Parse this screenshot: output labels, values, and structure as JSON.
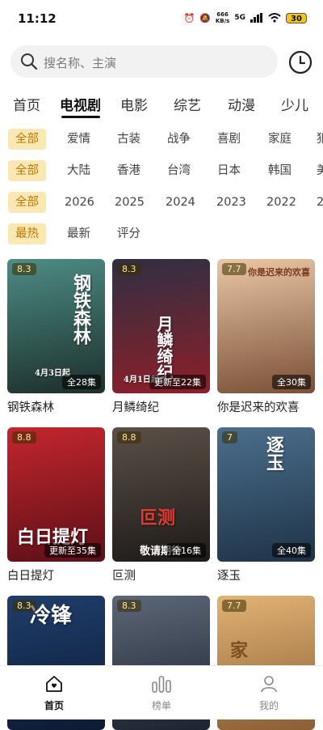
{
  "status": {
    "time": "11:12",
    "net_speed": "666",
    "net_unit": "KB/s",
    "signal": "5G",
    "battery": "30"
  },
  "search": {
    "placeholder": "搜名称、主演"
  },
  "categories": [
    "首页",
    "电视剧",
    "电影",
    "综艺",
    "动漫",
    "少儿"
  ],
  "filters": {
    "genre": [
      "全部",
      "爱情",
      "古装",
      "战争",
      "喜剧",
      "家庭",
      "犯"
    ],
    "region": [
      "全部",
      "大陆",
      "香港",
      "台湾",
      "日本",
      "韩国",
      "美"
    ],
    "year": [
      "全部",
      "2026",
      "2025",
      "2024",
      "2023",
      "2022",
      "2"
    ],
    "sort": [
      "最热",
      "最新",
      "评分"
    ]
  },
  "items": [
    {
      "title": "钢铁森林",
      "score": "8.3",
      "badge": "全28集",
      "poster_text": "钢铁森林",
      "poster_sub": "4月3日起",
      "colors": [
        "#4d8c84",
        "#1d2f2c"
      ]
    },
    {
      "title": "月鳞绮纪",
      "score": "8.3",
      "badge": "更新至22集",
      "poster_text": "月鳞绮纪",
      "poster_sub": "4月1日起",
      "colors": [
        "#2e3042",
        "#8e1f29"
      ]
    },
    {
      "title": "你是迟来的欢喜",
      "score": "7.7",
      "badge": "全30集",
      "poster_text": "你是迟来的欢喜",
      "poster_sub": "",
      "colors": [
        "#e9c7a6",
        "#7a4f36"
      ]
    },
    {
      "title": "白日提灯",
      "score": "8.8",
      "badge": "更新至35集",
      "poster_text": "白日提灯",
      "poster_sub": "",
      "colors": [
        "#c3262e",
        "#5d0f17"
      ]
    },
    {
      "title": "叵测",
      "score": "8.8",
      "badge": "全16集",
      "poster_text": "叵测",
      "poster_sub": "敬请期待",
      "colors": [
        "#5a5048",
        "#1f1a18"
      ]
    },
    {
      "title": "逐玉",
      "score": "7",
      "badge": "全40集",
      "poster_text": "逐玉",
      "poster_sub": "",
      "colors": [
        "#4b6e8c",
        "#1f3347"
      ]
    },
    {
      "title": "",
      "score": "8.3",
      "badge": "",
      "poster_text": "冷锋",
      "poster_sub": "",
      "colors": [
        "#1f3e6b",
        "#0d1a33"
      ]
    },
    {
      "title": "",
      "score": "8.3",
      "badge": "",
      "poster_text": "",
      "poster_sub": "",
      "colors": [
        "#5c6777",
        "#1c2330"
      ]
    },
    {
      "title": "",
      "score": "7.7",
      "badge": "",
      "poster_text": "家",
      "poster_sub": "",
      "colors": [
        "#e2b375",
        "#8b5e34"
      ]
    }
  ],
  "tabbar": [
    "首页",
    "榜单",
    "我的"
  ]
}
